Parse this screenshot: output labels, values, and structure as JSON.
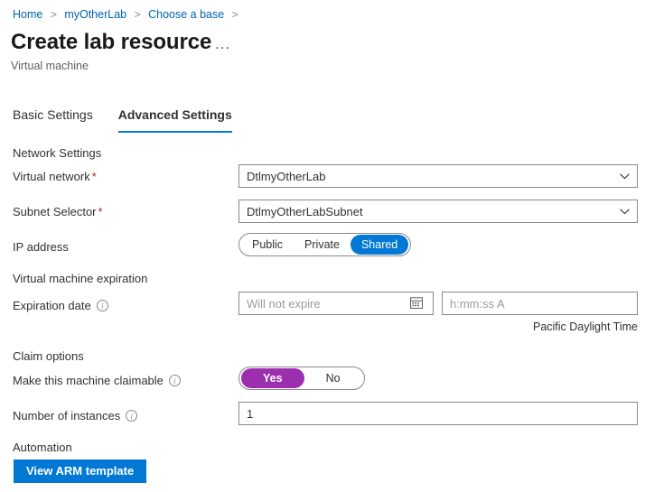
{
  "breadcrumb": {
    "items": [
      {
        "label": "Home"
      },
      {
        "label": "myOtherLab"
      },
      {
        "label": "Choose a base"
      }
    ],
    "separator": ">"
  },
  "header": {
    "title": "Create lab resource",
    "subtitle": "Virtual machine",
    "more_label": "..."
  },
  "tabs": [
    {
      "label": "Basic Settings",
      "active": false
    },
    {
      "label": "Advanced Settings",
      "active": true
    }
  ],
  "network_settings": {
    "heading": "Network Settings",
    "virtual_network": {
      "label": "Virtual network",
      "required_marker": "*",
      "value": "DtlmyOtherLab"
    },
    "subnet_selector": {
      "label": "Subnet Selector",
      "required_marker": "*",
      "value": "DtlmyOtherLabSubnet"
    },
    "ip_address": {
      "label": "IP address",
      "options": [
        "Public",
        "Private",
        "Shared"
      ],
      "selected": "Shared"
    }
  },
  "expiration": {
    "heading": "Virtual machine expiration",
    "date_label": "Expiration date",
    "date_value": "",
    "date_placeholder": "Will not expire",
    "time_value": "",
    "time_placeholder": "h:mm:ss A",
    "timezone_note": "Pacific Daylight Time"
  },
  "claim_options": {
    "heading": "Claim options",
    "claimable_label": "Make this machine claimable",
    "options": [
      "Yes",
      "No"
    ],
    "selected": "Yes",
    "instances_label": "Number of instances",
    "instances_value": "1"
  },
  "automation": {
    "heading": "Automation",
    "arm_button_label": "View ARM template"
  },
  "colors": {
    "accent_blue": "#0078d4",
    "link_blue": "#0063b1",
    "toggle_purple": "#9b2fae",
    "required_red": "#a4262c",
    "border_gray": "#8a8886"
  }
}
